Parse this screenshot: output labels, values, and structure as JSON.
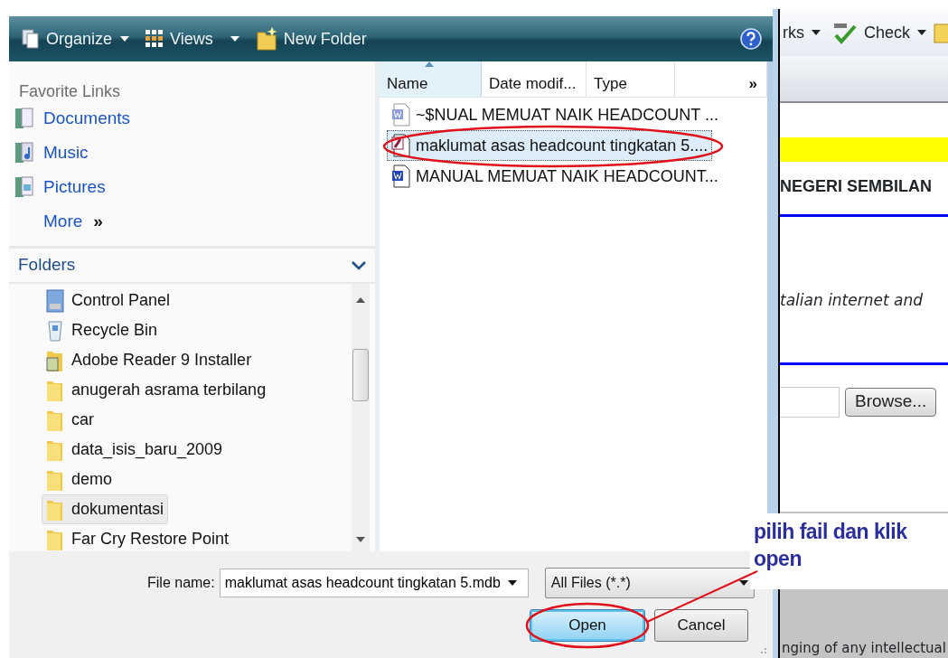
{
  "browser": {
    "toolbar": [
      {
        "label": "rks",
        "kind": "menu"
      },
      {
        "label": "Check",
        "kind": "spell-menu"
      }
    ],
    "content": {
      "heading": "NEGERI SEMBILAN",
      "italic_text": "talian internet and",
      "browse_button": "Browse...",
      "footer_text": "nging of any intellectual"
    }
  },
  "dialog": {
    "toolbar": [
      {
        "label": "Organize",
        "kind": "organize"
      },
      {
        "label": "Views",
        "kind": "views"
      },
      {
        "label": "New Folder",
        "kind": "new-folder"
      }
    ],
    "favorite_links": {
      "title": "Favorite Links",
      "items": [
        {
          "label": "Documents",
          "kind": "documents"
        },
        {
          "label": "Music",
          "kind": "music"
        },
        {
          "label": "Pictures",
          "kind": "pictures"
        }
      ],
      "more": "More",
      "more_glyph": "»"
    },
    "folders": {
      "title": "Folders",
      "items": [
        {
          "label": "Control Panel",
          "kind": "control-panel",
          "selected": false
        },
        {
          "label": "Recycle Bin",
          "kind": "recycle-bin",
          "selected": false
        },
        {
          "label": "Adobe Reader 9 Installer",
          "kind": "installer",
          "selected": false
        },
        {
          "label": "anugerah asrama terbilang",
          "kind": "folder",
          "selected": false
        },
        {
          "label": "car",
          "kind": "folder",
          "selected": false
        },
        {
          "label": "data_isis_baru_2009",
          "kind": "folder",
          "selected": false
        },
        {
          "label": "demo",
          "kind": "folder",
          "selected": false
        },
        {
          "label": "dokumentasi",
          "kind": "folder",
          "selected": true
        },
        {
          "label": "Far Cry Restore Point",
          "kind": "folder",
          "selected": false
        }
      ]
    },
    "file_list": {
      "columns": [
        {
          "label": "Name",
          "sorted": true
        },
        {
          "label": "Date modif...",
          "sorted": false
        },
        {
          "label": "Type",
          "sorted": false
        }
      ],
      "more_columns": "»",
      "files": [
        {
          "name": "~$NUAL MEMUAT NAIK HEADCOUNT ...",
          "kind": "word-temp",
          "selected": false
        },
        {
          "name": "maklumat asas headcount tingkatan 5....",
          "kind": "database",
          "selected": true
        },
        {
          "name": "MANUAL MEMUAT NAIK HEADCOUNT...",
          "kind": "word",
          "selected": false
        }
      ]
    },
    "file_name": {
      "label": "File name:",
      "value": "maklumat asas headcount tingkatan 5.mdb"
    },
    "file_type": {
      "value": "All Files (*.*)"
    },
    "buttons": [
      {
        "label": "Open",
        "default": true
      },
      {
        "label": "Cancel",
        "default": false
      }
    ]
  },
  "annotation": {
    "text": "pilih fail dan klik open"
  }
}
